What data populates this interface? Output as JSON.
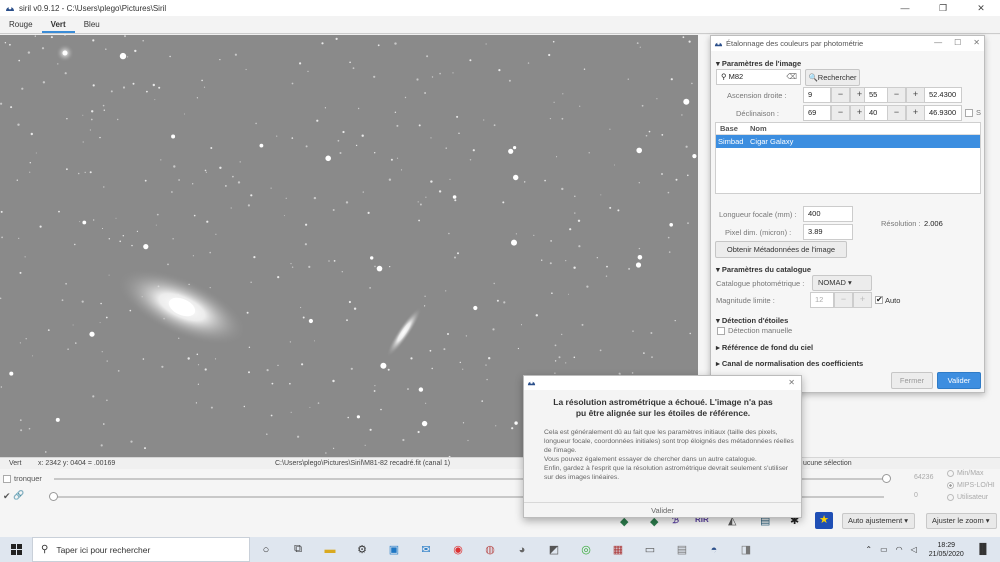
{
  "window": {
    "title": "siril v0.9.12 - C:\\Users\\plego\\Pictures\\Siril",
    "controls": [
      "—",
      "❐",
      "✕"
    ]
  },
  "channel_tabs": [
    "Rouge",
    "Vert",
    "Bleu"
  ],
  "status_bar": {
    "channel": "Vert",
    "coords": "x: 2342 y: 0404 = .00169",
    "file": "C:\\Users\\plego\\Pictures\\Siril\\M81-82 recadré.fit (canal 1)",
    "selection": "ucune sélection"
  },
  "bottom": {
    "truncate_label": "tronquer",
    "high_value": "64236",
    "low_value": "0",
    "radio": [
      "Min/Max",
      "MIPS-LO/HI",
      "Utilisateur"
    ],
    "auto_adjust": "Auto ajustement",
    "zoom": "Ajuster le zoom"
  },
  "taskbar": {
    "search_placeholder": "Taper ici pour rechercher",
    "time": "18:29",
    "date": "21/05/2020"
  },
  "pcc": {
    "title": "Étalonnage des couleurs par photométrie",
    "image_params": "Paramètres de l'image",
    "search_value": "M82",
    "search_button": "Rechercher",
    "ra_label": "Ascension droite :",
    "ra": [
      "9",
      "55",
      "52.4300"
    ],
    "dec_label": "Déclinaison :",
    "dec": [
      "69",
      "40",
      "46.9300"
    ],
    "s_label": "S",
    "table_headers": [
      "Base",
      "Nom"
    ],
    "table_rows": [
      {
        "base": "Simbad",
        "name": "Cigar Galaxy"
      }
    ],
    "focal_label": "Longueur focale (mm) :",
    "focal_value": "400",
    "pixel_label": "Pixel dim. (micron) :",
    "pixel_value": "3.89",
    "resolution_label": "Résolution :",
    "resolution_value": "2.006",
    "meta_button": "Obtenir Métadonnées de l'image",
    "catalog_params": "Paramètres du catalogue",
    "catalog_label": "Catalogue photométrique :",
    "catalog_value": "NOMAD",
    "maglim_label": "Magnitude limite :",
    "maglim_value": "12",
    "auto_label": "Auto",
    "star_detect": "Détection d'étoiles",
    "manual_detect": "Détection manuelle",
    "sky_bg": "Référence de fond du ciel",
    "norm_channel": "Canal de normalisation des coefficients",
    "close_button": "Fermer",
    "validate_button": "Valider"
  },
  "error": {
    "primary": "La résolution astrométrique a échoué. L'image n'a pas pu être alignée sur les étoiles de référence.",
    "secondary": "Cela est généralement dû au fait que les paramètres initiaux (taille des pixels, longueur focale, coordonnées initiales) sont trop éloignés des métadonnées réelles de l'image.\nVous pouvez également essayer de chercher dans un autre catalogue.\nEnfin, gardez à l'esprit que la résolution astrométrique devrait seulement s'utiliser sur des images linéaires.",
    "ok": "Valider"
  }
}
